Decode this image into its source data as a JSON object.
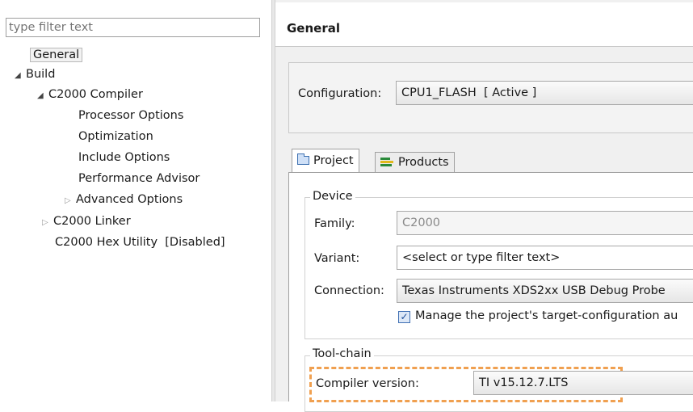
{
  "left": {
    "filter_placeholder": "type filter text",
    "tree": {
      "general": "General",
      "build": "Build",
      "c2000_compiler": "C2000 Compiler",
      "processor_options": "Processor Options",
      "optimization": "Optimization",
      "include_options": "Include Options",
      "performance_advisor": "Performance Advisor",
      "advanced_options": "Advanced Options",
      "c2000_linker": "C2000 Linker",
      "hex_utility": "C2000 Hex Utility  [Disabled]"
    }
  },
  "right": {
    "title": "General",
    "configuration_label": "Configuration:",
    "configuration_value": "CPU1_FLASH  [ Active ]",
    "tabs": [
      "Project",
      "Products"
    ],
    "device_legend": "Device",
    "family_label": "Family:",
    "family_value": "C2000",
    "variant_label": "Variant:",
    "variant_value": "<select or type filter text>",
    "connection_label": "Connection:",
    "connection_value": "Texas Instruments XDS2xx USB Debug Probe",
    "manage_checkbox_label": "Manage the project's target-configuration au",
    "manage_checked": true,
    "toolchain_legend": "Tool-chain",
    "compiler_version_label": "Compiler version:",
    "compiler_version_value": "TI v15.12.7.LTS"
  },
  "colors": {
    "highlight": "#f0a050",
    "top_strip": "#ffff00",
    "checkbox_accent": "#3f6fb3"
  },
  "icons": {
    "project_tab": "folder-icon",
    "products_tab": "products-icon",
    "tree_expanded": "triangle-down-icon",
    "tree_collapsed": "triangle-right-icon"
  }
}
